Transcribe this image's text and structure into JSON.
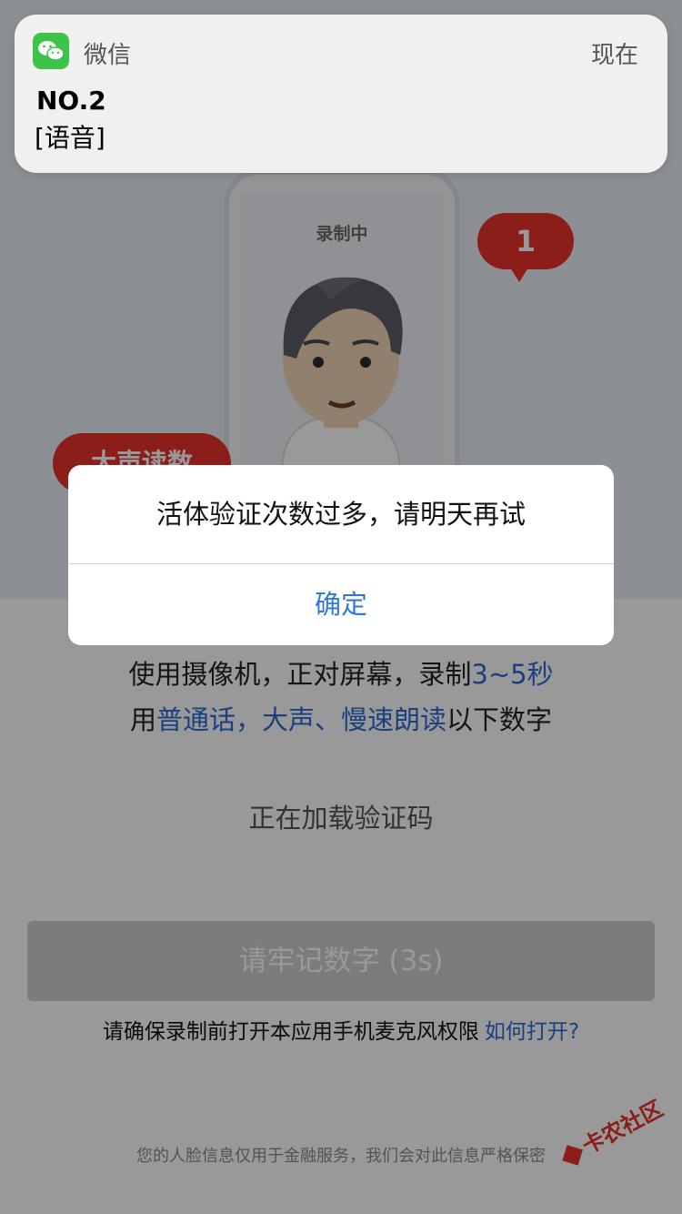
{
  "notification": {
    "app_name": "微信",
    "time": "现在",
    "title": "NO.2",
    "body": "[语音]",
    "icon": "wechat-icon"
  },
  "illustration": {
    "screen_label": "录制中",
    "bubble_number": "1",
    "bubble_text": "大声读数"
  },
  "alert": {
    "message": "活体验证次数过多，请明天再试",
    "ok_label": "确定"
  },
  "instructions": {
    "line1_prefix": "使用摄像机，正对屏幕，录制",
    "line1_highlight": "3~5秒",
    "line2_prefix": "用",
    "line2_highlight": "普通话，大声、慢速朗读",
    "line2_suffix": "以下数字"
  },
  "loading_text": "正在加载验证码",
  "remember_button": "请牢记数字 (3s)",
  "mic_note": {
    "text": "请确保录制前打开本应用手机麦克风权限",
    "link": "如何打开?"
  },
  "privacy_note": "您的人脸信息仅用于金融服务，我们会对此信息严格保密",
  "watermark": "卡农社区",
  "colors": {
    "accent_blue": "#2c6bd6",
    "bubble_red": "#e8332b",
    "wechat_green": "#3dc24a"
  }
}
